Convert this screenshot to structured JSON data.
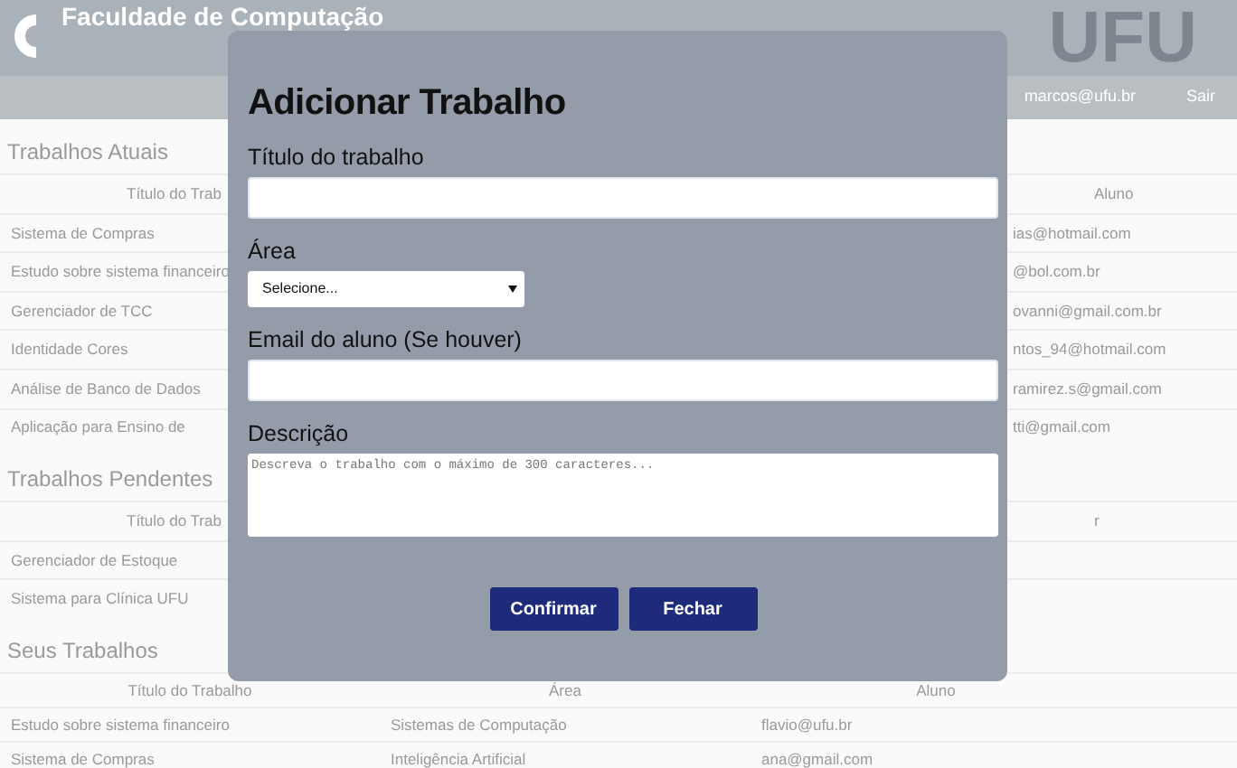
{
  "header": {
    "title": "Faculdade de Computação",
    "logo_text": "UFU"
  },
  "nav": {
    "user": "marcos@ufu.br",
    "logout": "Sair"
  },
  "sections": [
    {
      "title": "Trabalhos Atuais",
      "kind": "covered",
      "columns": [
        "Título do Trab",
        "Aluno"
      ],
      "rows": [
        [
          "Sistema de Compras",
          "ias@hotmail.com"
        ],
        [
          "Estudo sobre sistema financeiro",
          "@bol.com.br"
        ],
        [
          "Gerenciador de TCC",
          "ovanni@gmail.com.br"
        ],
        [
          "Identidade Cores",
          "ntos_94@hotmail.com"
        ],
        [
          "Análise de Banco de Dados",
          "ramirez.s@gmail.com"
        ],
        [
          "Aplicação para Ensino de",
          "tti@gmail.com"
        ]
      ]
    },
    {
      "title": "Trabalhos Pendentes",
      "kind": "covered",
      "columns": [
        "Título do Trab",
        "r"
      ],
      "rows": [
        [
          "Gerenciador de Estoque",
          ""
        ],
        [
          "Sistema para Clínica UFU",
          ""
        ]
      ]
    },
    {
      "title": "Seus Trabalhos",
      "kind": "full",
      "columns": [
        "Título do Trabalho",
        "Área",
        "Aluno"
      ],
      "rows": [
        [
          "Estudo sobre sistema financeiro",
          "Sistemas de Computação",
          "flavio@ufu.br"
        ],
        [
          "Sistema de Compras",
          "Inteligência Artificial",
          "ana@gmail.com"
        ]
      ]
    }
  ],
  "modal": {
    "title": "Adicionar Trabalho",
    "fields": [
      {
        "kind": "text",
        "label": "Título do trabalho"
      },
      {
        "kind": "select",
        "label": "Área",
        "value": "Selecione..."
      },
      {
        "kind": "text",
        "label": "Email do aluno (Se houver)"
      },
      {
        "kind": "textarea",
        "label": "Descrição",
        "placeholder": "Descreva o trabalho com o máximo de 300 caracteres..."
      }
    ],
    "buttons": [
      "Confirmar",
      "Fechar"
    ]
  }
}
